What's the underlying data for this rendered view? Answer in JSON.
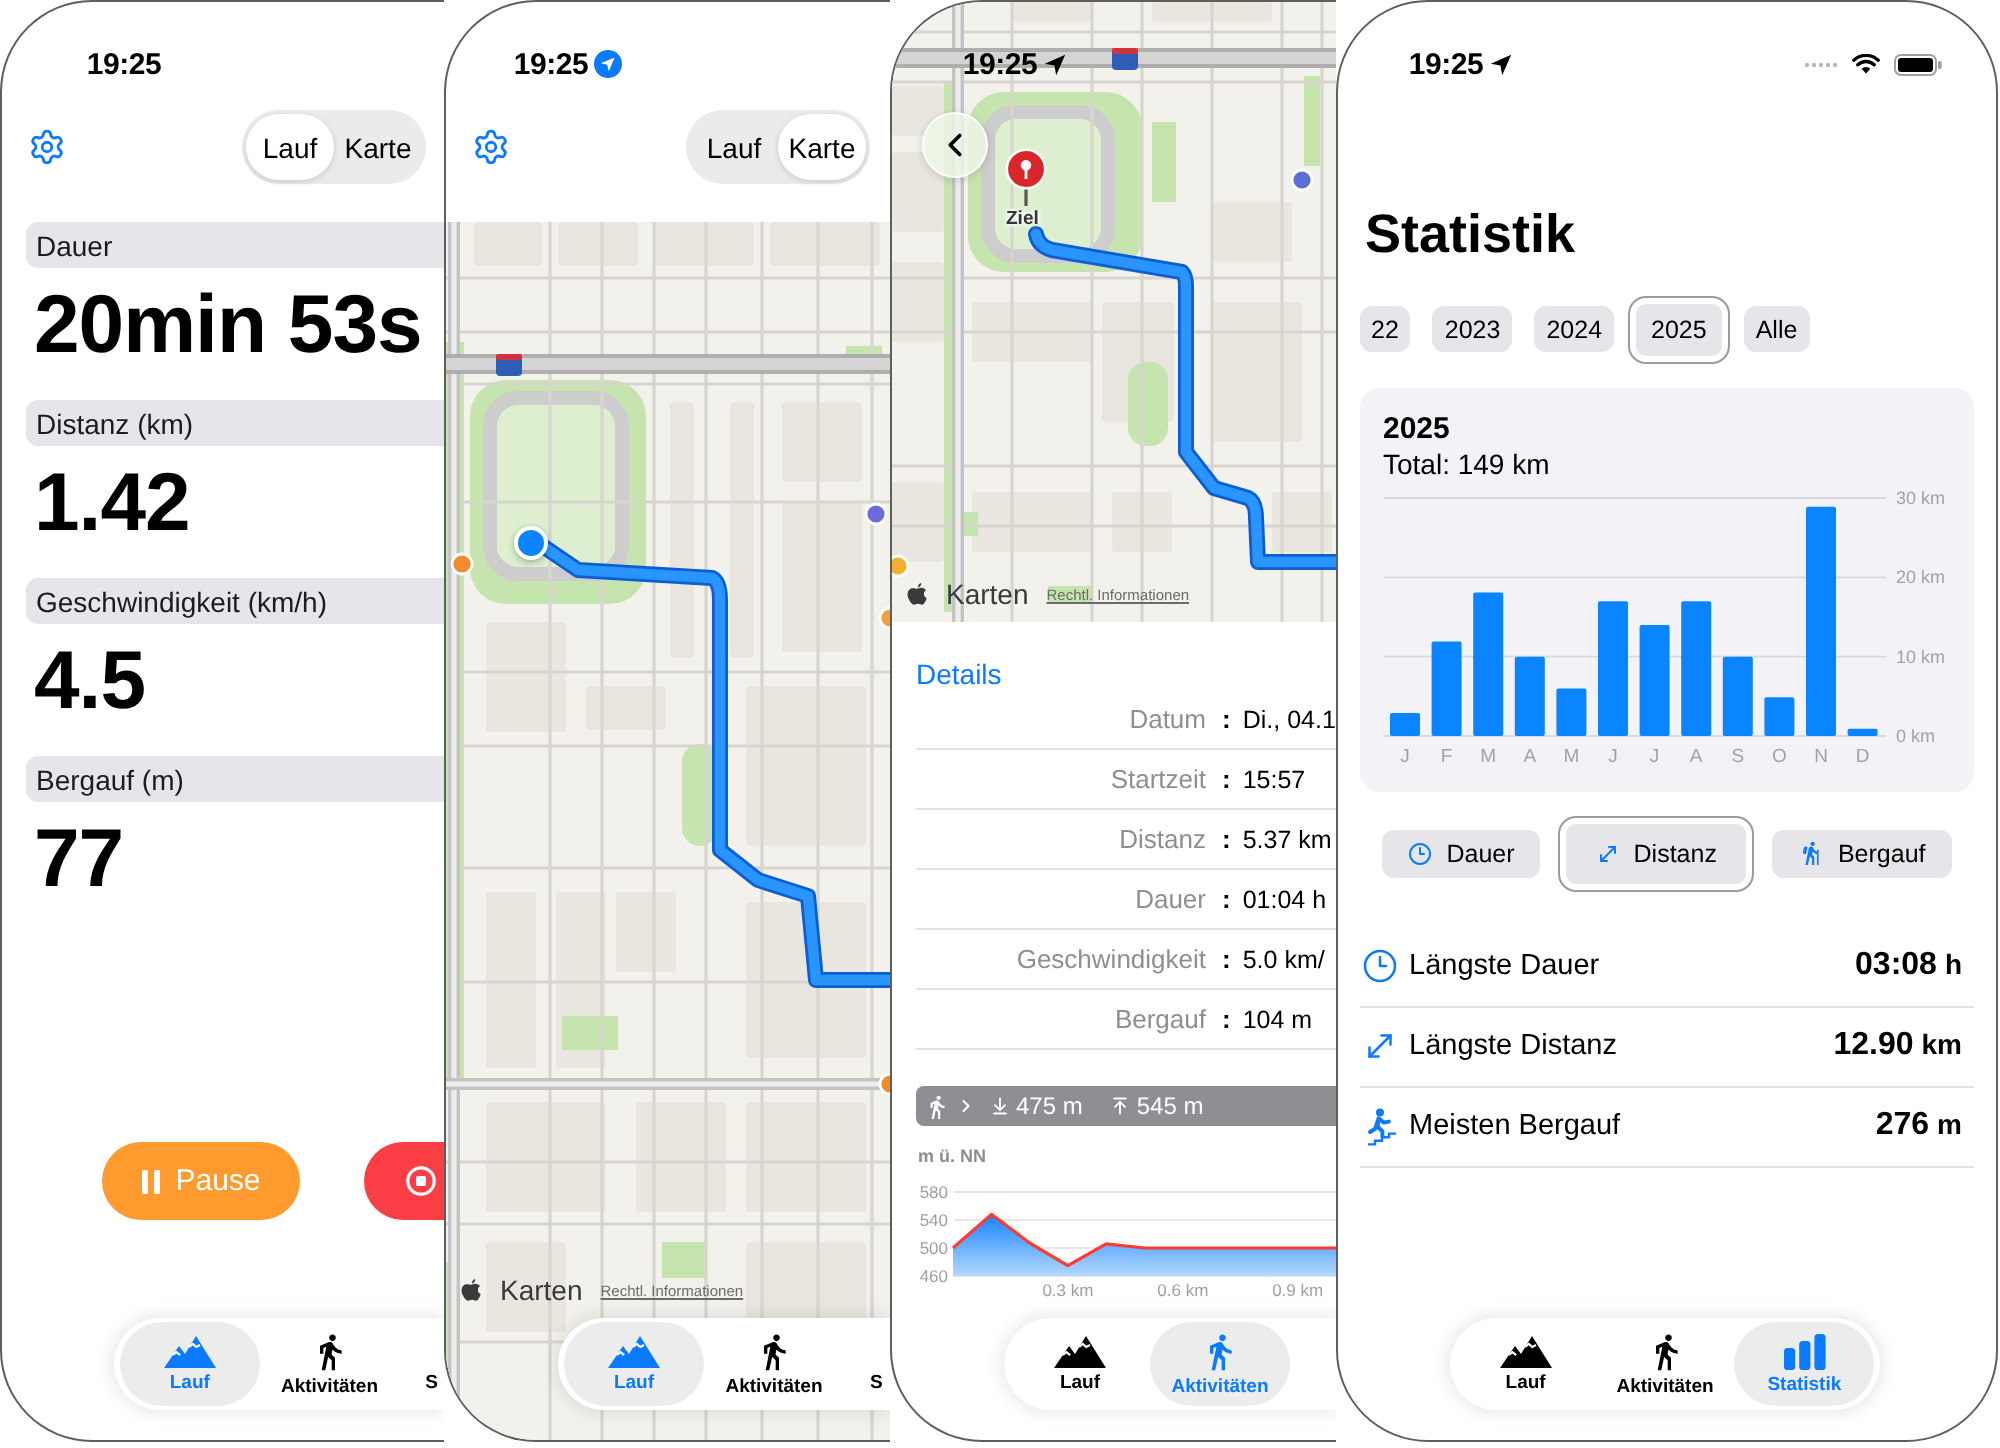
{
  "phones": [
    {
      "kind": "run",
      "status_bar": {
        "time": "19:25"
      },
      "segmented_control": [
        {
          "label": "Lauf",
          "selected": true
        },
        {
          "label": "Karte",
          "selected": false
        }
      ],
      "metrics": [
        {
          "label": "Dauer",
          "value": "20min 53s"
        },
        {
          "label": "Distanz (km)",
          "value": "1.42"
        },
        {
          "label": "Geschwindigkeit (km/h)",
          "value": "4.5"
        },
        {
          "label": "Bergauf (m)",
          "value": "77"
        }
      ],
      "controls": [
        {
          "kind": "pause",
          "label": "Pause"
        },
        {
          "kind": "stop"
        }
      ],
      "tab_bar": [
        {
          "kind": "run",
          "label": "Lauf",
          "selected": true
        },
        {
          "kind": "activities",
          "label": "Aktivitäten",
          "selected": false
        },
        {
          "label": "S",
          "selected": false
        }
      ]
    },
    {
      "kind": "map",
      "status_bar": {
        "time": "19:25",
        "location_indicator": {
          "kind": "badge"
        }
      },
      "segmented_control": [
        {
          "label": "Lauf",
          "selected": false
        },
        {
          "label": "Karte",
          "selected": true
        }
      ],
      "map": {
        "attribution": {
          "logo": "Karten",
          "legal": "Rechtl. Informationen"
        }
      },
      "tab_bar": [
        {
          "kind": "run",
          "label": "Lauf",
          "selected": true
        },
        {
          "kind": "activities",
          "label": "Aktivitäten",
          "selected": false
        },
        {
          "label": "S",
          "selected": false
        }
      ]
    },
    {
      "kind": "activity",
      "status_bar": {
        "time": "19:25",
        "location_indicator": {
          "kind": "arrow"
        }
      },
      "map": {
        "pin_label": "Ziel",
        "attribution": {
          "logo": "Karten",
          "legal": "Rechtl. Informationen"
        }
      },
      "details": {
        "title": "Details",
        "rows": [
          {
            "label": "Datum",
            "separator": ":",
            "value": "Di., 04.1"
          },
          {
            "label": "Startzeit",
            "separator": ":",
            "value": "15:57"
          },
          {
            "label": "Distanz",
            "separator": ":",
            "value": "5.37 km"
          },
          {
            "label": "Dauer",
            "separator": ":",
            "value": "01:04 h"
          },
          {
            "label": "Geschwindigkeit",
            "separator": ":",
            "value": "5.0 km/"
          },
          {
            "label": "Bergauf",
            "separator": ":",
            "value": "104 m"
          }
        ]
      },
      "elevation_summary": {
        "descent": "475 m",
        "ascent": "545 m"
      },
      "elevation_chart": {
        "chart_data": {
          "type": "area",
          "ylabel": "m ü. NN",
          "x": [
            0,
            0.1,
            0.2,
            0.3,
            0.4,
            0.5,
            1.0
          ],
          "series": [
            {
              "color": "#ff3b30",
              "values": [
                500,
                548,
                507,
                475,
                506,
                500,
                500
              ]
            }
          ],
          "xlim": [
            0,
            1.0
          ],
          "ylim": [
            460,
            580
          ],
          "yticks": [
            580,
            540,
            500,
            460
          ],
          "xticks": [
            {
              "value": 0.3,
              "label": "0.3 km"
            },
            {
              "value": 0.6,
              "label": "0.6 km"
            },
            {
              "value": 0.9,
              "label": "0.9 km"
            }
          ]
        }
      },
      "tab_bar": [
        {
          "kind": "run",
          "label": "Lauf",
          "selected": false
        },
        {
          "kind": "activities",
          "label": "Aktivitäten",
          "selected": true
        }
      ]
    },
    {
      "kind": "statistics",
      "status_bar": {
        "time": "19:25",
        "location_indicator": {
          "kind": "arrow"
        },
        "system_icons": true
      },
      "title": "Statistik",
      "year_filter": [
        {
          "label": "22",
          "selected": false
        },
        {
          "label": "2023",
          "selected": false
        },
        {
          "label": "2024",
          "selected": false
        },
        {
          "label": "2025",
          "selected": true
        },
        {
          "label": "Alle",
          "selected": false
        }
      ],
      "chart_card": {
        "title": "2025",
        "total": "Total: 149 km",
        "chart_data": {
          "type": "bar",
          "categories": [
            "J",
            "F",
            "M",
            "A",
            "M",
            "J",
            "J",
            "A",
            "S",
            "O",
            "N",
            "D"
          ],
          "series": [
            {
              "color": "#0a84ff",
              "values": [
                2.9,
                11.9,
                18.1,
                10,
                6,
                17,
                14,
                17,
                10,
                4.9,
                28.9,
                0.9
              ]
            }
          ],
          "ylim": [
            0,
            30
          ],
          "yticks": [
            {
              "value": 0,
              "label": "0 km"
            },
            {
              "value": 10,
              "label": "10 km"
            },
            {
              "value": 20,
              "label": "20 km"
            },
            {
              "value": 30,
              "label": "30 km"
            }
          ]
        }
      },
      "metric_toggle": [
        {
          "kind": "duration",
          "label": "Dauer",
          "selected": false
        },
        {
          "kind": "distance",
          "label": "Distanz",
          "selected": true
        },
        {
          "kind": "elevation",
          "label": "Bergauf",
          "selected": false
        }
      ],
      "records": [
        {
          "kind": "duration",
          "label": "Längste Dauer",
          "value": "03:08",
          "unit": "h"
        },
        {
          "kind": "distance",
          "label": "Längste Distanz",
          "value": "12.90",
          "unit": "km"
        },
        {
          "kind": "elevation",
          "label": "Meisten Bergauf",
          "value": "276",
          "unit": "m"
        }
      ],
      "tab_bar": [
        {
          "kind": "run",
          "label": "Lauf",
          "selected": false
        },
        {
          "kind": "activities",
          "label": "Aktivitäten",
          "selected": false
        },
        {
          "kind": "statistics",
          "label": "Statistik",
          "selected": true
        }
      ]
    }
  ]
}
